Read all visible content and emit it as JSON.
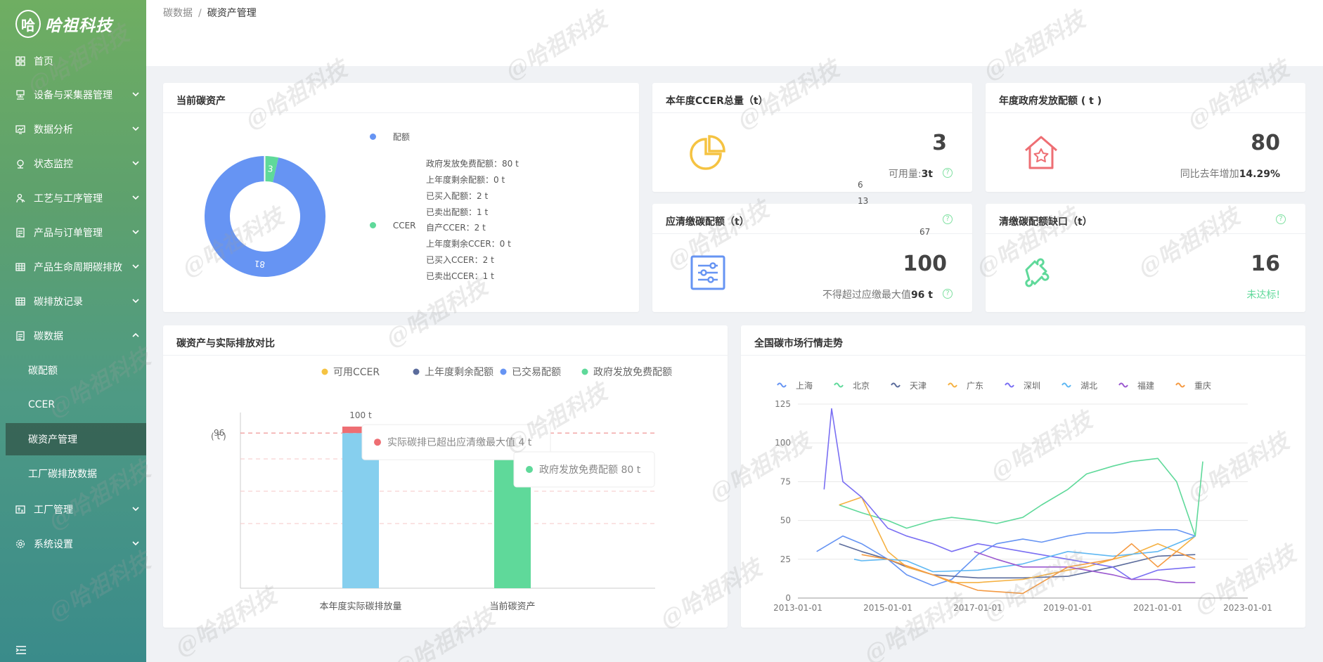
{
  "app": {
    "logo_char": "哈",
    "logo_name": "哈祖科技",
    "watermark": "@哈祖科技"
  },
  "sidebar": {
    "items": [
      {
        "label": "首页",
        "icon": "dashboard-icon"
      },
      {
        "label": "设备与采集器管理",
        "icon": "device-icon"
      },
      {
        "label": "数据分析",
        "icon": "chart-icon"
      },
      {
        "label": "状态监控",
        "icon": "monitor-icon"
      },
      {
        "label": "工艺与工序管理",
        "icon": "process-icon"
      },
      {
        "label": "产品与订单管理",
        "icon": "order-icon"
      },
      {
        "label": "产品生命周期碳排放",
        "icon": "table-icon"
      },
      {
        "label": "碳排放记录",
        "icon": "table-icon"
      },
      {
        "label": "碳数据",
        "icon": "document-icon"
      }
    ],
    "subitems": [
      "碳配额",
      "CCER",
      "碳资产管理",
      "工厂碳排放数据"
    ],
    "items2": [
      {
        "label": "工厂管理",
        "icon": "factory-icon"
      },
      {
        "label": "系统设置",
        "icon": "gear-icon"
      }
    ]
  },
  "breadcrumb": {
    "parent": "碳数据",
    "separator": "/",
    "current": "碳资产管理"
  },
  "assets_card": {
    "title": "当前碳资产",
    "donut": {
      "quota": 81,
      "ccer": 3,
      "quota_label": "81",
      "ccer_label": "3"
    },
    "legend": {
      "quota_name": "配额",
      "ccer_name": "CCER",
      "quota_lines": [
        "政府发放免费配额：80 t",
        "上年度剩余配额：0 t",
        "已买入配额：2 t",
        "已卖出配额：1 t"
      ],
      "ccer_lines": [
        "自产CCER：2 t",
        "上年度剩余CCER：0 t",
        "已买入CCER：2 t",
        "已卖出CCER：1 t"
      ]
    },
    "colors": {
      "quota": "#6694f3",
      "ccer": "#5fd99a"
    }
  },
  "ccer_card": {
    "title": "本年度CCER总量（t）",
    "value": "3",
    "sub_label": "可用量:",
    "sub_value": "3t",
    "icon": "pie-chart-icon"
  },
  "gov_card": {
    "title": "年度政府发放配额 ( t )",
    "value": "80",
    "sub_label": "同比去年增加",
    "sub_value": "14.29%",
    "icon": "house-star-icon"
  },
  "clear_card": {
    "title": "应清缴碳配额（t）",
    "value": "100",
    "sub_label": "不得超过应缴最大值",
    "sub_value": "96 t",
    "icon": "slider-list-icon"
  },
  "gap_card": {
    "title": "清缴碳配额缺口（t）",
    "value": "16",
    "sub_value": "未达标!",
    "icon": "puzzle-icon"
  },
  "stray_labels": [
    "6",
    "13",
    "67"
  ],
  "compare_chart": {
    "title": "碳资产与实际排放对比",
    "chart_data": {
      "type": "bar",
      "title": "碳资产与实际排放对比",
      "ylabel": "( t )",
      "categories": [
        "本年度实际碳排放量",
        "当前碳资产"
      ],
      "legend": [
        "可用CCER",
        "上年度剩余配额",
        "已交易配额",
        "政府发放免费配额"
      ],
      "legend_colors": [
        "#f5c342",
        "#5b6c9c",
        "#6694f3",
        "#5fd99a"
      ],
      "series": [
        {
          "name": "实际碳排放",
          "category": "本年度实际碳排放量",
          "values": [
            96,
            4
          ],
          "colors": [
            "#86cfee",
            "#ee6e73"
          ]
        },
        {
          "name": "当前碳资产",
          "category": "当前碳资产",
          "values": [
            80,
            3,
            2,
            3
          ],
          "colors": [
            "#5fd99a",
            "#6694f3",
            "#5b6c9c",
            "#f5c342"
          ]
        }
      ],
      "top_label": "100 t",
      "ref_line": {
        "value": 96,
        "label": "96"
      },
      "ylim": [
        0,
        100
      ],
      "tooltip1": "实际碳排已超出应清缴最大值 4 t",
      "tooltip1_color": "#ee6e73",
      "tooltip2": "政府发放免费配额  80 t",
      "tooltip2_color": "#5fd99a"
    }
  },
  "market_chart": {
    "title": "全国碳市场行情走势",
    "chart_data": {
      "type": "line",
      "legend": [
        "上海",
        "北京",
        "天津",
        "广东",
        "深圳",
        "湖北",
        "福建",
        "重庆"
      ],
      "colors": [
        "#6694f3",
        "#5fd99a",
        "#5b6c9c",
        "#f5b142",
        "#7a6ff3",
        "#5fb8f3",
        "#9b59d0",
        "#f59a42"
      ],
      "x_ticks": [
        "2013-01-01",
        "2015-01-01",
        "2017-01-01",
        "2019-01-01",
        "2021-01-01",
        "2023-01-01"
      ],
      "y_ticks": [
        0,
        25,
        50,
        75,
        100,
        125
      ],
      "ylim": [
        0,
        125
      ],
      "xlim": [
        "2013-01-01",
        "2023-01-01"
      ],
      "series": [
        {
          "name": "上海",
          "x": [
            "2013-06",
            "2014-01",
            "2014-06",
            "2015-01",
            "2015-06",
            "2016-01",
            "2016-06",
            "2017-01",
            "2017-06",
            "2018-01",
            "2018-06",
            "2019-01",
            "2019-06",
            "2020-01",
            "2020-06",
            "2021-01",
            "2021-06",
            "2021-11"
          ],
          "y": [
            30,
            40,
            35,
            25,
            15,
            8,
            12,
            28,
            35,
            38,
            36,
            40,
            42,
            42,
            43,
            44,
            44,
            40
          ]
        },
        {
          "name": "北京",
          "x": [
            "2013-12",
            "2014-06",
            "2015-01",
            "2015-06",
            "2016-01",
            "2016-06",
            "2017-01",
            "2017-06",
            "2018-01",
            "2018-06",
            "2019-01",
            "2019-06",
            "2020-01",
            "2020-06",
            "2021-01",
            "2021-06",
            "2021-11",
            "2022-01"
          ],
          "y": [
            60,
            55,
            50,
            45,
            50,
            52,
            50,
            48,
            52,
            60,
            70,
            80,
            85,
            88,
            90,
            75,
            40,
            88
          ]
        },
        {
          "name": "天津",
          "x": [
            "2013-12",
            "2014-06",
            "2015-01",
            "2015-06",
            "2016-01",
            "2017-01",
            "2018-01",
            "2019-01",
            "2020-01",
            "2021-01",
            "2021-11"
          ],
          "y": [
            35,
            30,
            25,
            20,
            15,
            13,
            13,
            14,
            20,
            27,
            28
          ]
        },
        {
          "name": "广东",
          "x": [
            "2013-12",
            "2014-06",
            "2015-01",
            "2015-06",
            "2016-01",
            "2016-06",
            "2017-01",
            "2018-01",
            "2019-01",
            "2019-06",
            "2020-01",
            "2020-06",
            "2021-01",
            "2021-06",
            "2021-11"
          ],
          "y": [
            60,
            65,
            30,
            20,
            15,
            10,
            10,
            12,
            18,
            20,
            25,
            28,
            35,
            30,
            40
          ]
        },
        {
          "name": "深圳",
          "x": [
            "2013-08",
            "2013-10",
            "2014-01",
            "2014-06",
            "2015-01",
            "2015-06",
            "2016-01",
            "2016-06",
            "2017-01",
            "2018-01",
            "2019-01",
            "2020-01",
            "2020-06",
            "2021-01",
            "2021-11"
          ],
          "y": [
            70,
            122,
            75,
            65,
            45,
            40,
            35,
            30,
            35,
            30,
            25,
            20,
            12,
            18,
            20
          ]
        },
        {
          "name": "湖北",
          "x": [
            "2014-04",
            "2014-06",
            "2015-01",
            "2015-06",
            "2016-01",
            "2017-01",
            "2018-01",
            "2019-01",
            "2020-01",
            "2021-01",
            "2021-11"
          ],
          "y": [
            25,
            24,
            25,
            24,
            17,
            18,
            22,
            30,
            27,
            30,
            40
          ]
        },
        {
          "name": "福建",
          "x": [
            "2016-12",
            "2017-06",
            "2018-01",
            "2019-01",
            "2019-06",
            "2020-01",
            "2020-06",
            "2021-01",
            "2021-06",
            "2021-11"
          ],
          "y": [
            30,
            25,
            20,
            20,
            18,
            15,
            12,
            12,
            10,
            10
          ]
        },
        {
          "name": "重庆",
          "x": [
            "2014-06",
            "2015-01",
            "2016-01",
            "2017-01",
            "2018-01",
            "2019-01",
            "2020-01",
            "2020-06",
            "2021-01",
            "2021-06",
            "2021-11"
          ],
          "y": [
            28,
            25,
            15,
            5,
            3,
            20,
            25,
            35,
            20,
            30,
            25
          ]
        }
      ]
    }
  }
}
